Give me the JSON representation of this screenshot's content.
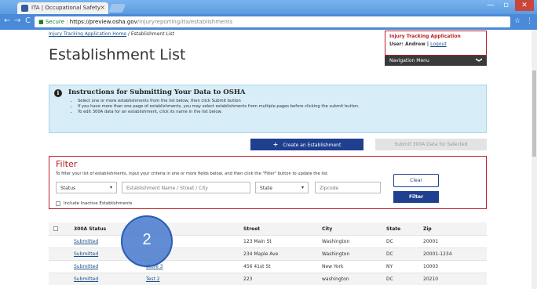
{
  "browser": {
    "tab_title": "ITA | Occupational Safety",
    "tab_close": "×",
    "url_secure": "Secure",
    "url_host": "https://preview.osha.gov",
    "url_path": "/injuryreporting/ita/establishments",
    "back": "←",
    "forward": "→",
    "reload": "C",
    "star": "☆",
    "menu": "⋮",
    "minimize": "—",
    "maximize": "▫",
    "close": "✕"
  },
  "header": {
    "breadcrumb_home": "Injury Tracking Application Home",
    "breadcrumb_sep": " / ",
    "breadcrumb_current": "Establishment List",
    "page_title": "Establishment List",
    "app_title": "Injury Tracking Application",
    "user_label": "User: Andrew | ",
    "logout": "Logout",
    "nav_menu": "Navigation Menu",
    "nav_chevron": "❯"
  },
  "instructions": {
    "title": "Instructions for Submitting Your Data to OSHA",
    "items": [
      "Select one or more establishments from the list below, then click Submit button",
      "If you have more than one page of establishments, you may select establishments from multiple pages before clicking the submit button.",
      "To edit 300A data for an establishment, click its name in the list below."
    ]
  },
  "actions": {
    "create_label": "Create an Establishment",
    "create_icon": "+",
    "submit_label": "Submit 300A Data for Selected"
  },
  "filter": {
    "title": "Filter",
    "help": "To filter your list of establishments, input your criteria in one or more fields below, and then click the \"Filter\" button to update the list.",
    "status_value": "Status",
    "name_placeholder": "Establishment Name / Street / City",
    "state_value": "State",
    "zip_placeholder": "Zipcode",
    "clear_label": "Clear",
    "filter_label": "Filter",
    "inactive_label": "Include Inactive Establishments"
  },
  "table": {
    "columns": [
      "300A Status",
      "Street",
      "City",
      "State",
      "Zip"
    ],
    "rows": [
      {
        "status": "Submitted",
        "name": "",
        "street": "123 Main St",
        "city": "Washington",
        "state": "DC",
        "zip": "20001"
      },
      {
        "status": "Submitted",
        "name": "",
        "street": "234 Maple Ave",
        "city": "Washington",
        "state": "DC",
        "zip": "20001-1234"
      },
      {
        "status": "Submitted",
        "name": "Store 3",
        "street": "456 41st St",
        "city": "New York",
        "state": "NY",
        "zip": "10003"
      },
      {
        "status": "Submitted",
        "name": "Test 2",
        "street": "223",
        "city": "washington",
        "state": "DC",
        "zip": "20210"
      }
    ]
  },
  "overlay": {
    "step_number": "2"
  }
}
